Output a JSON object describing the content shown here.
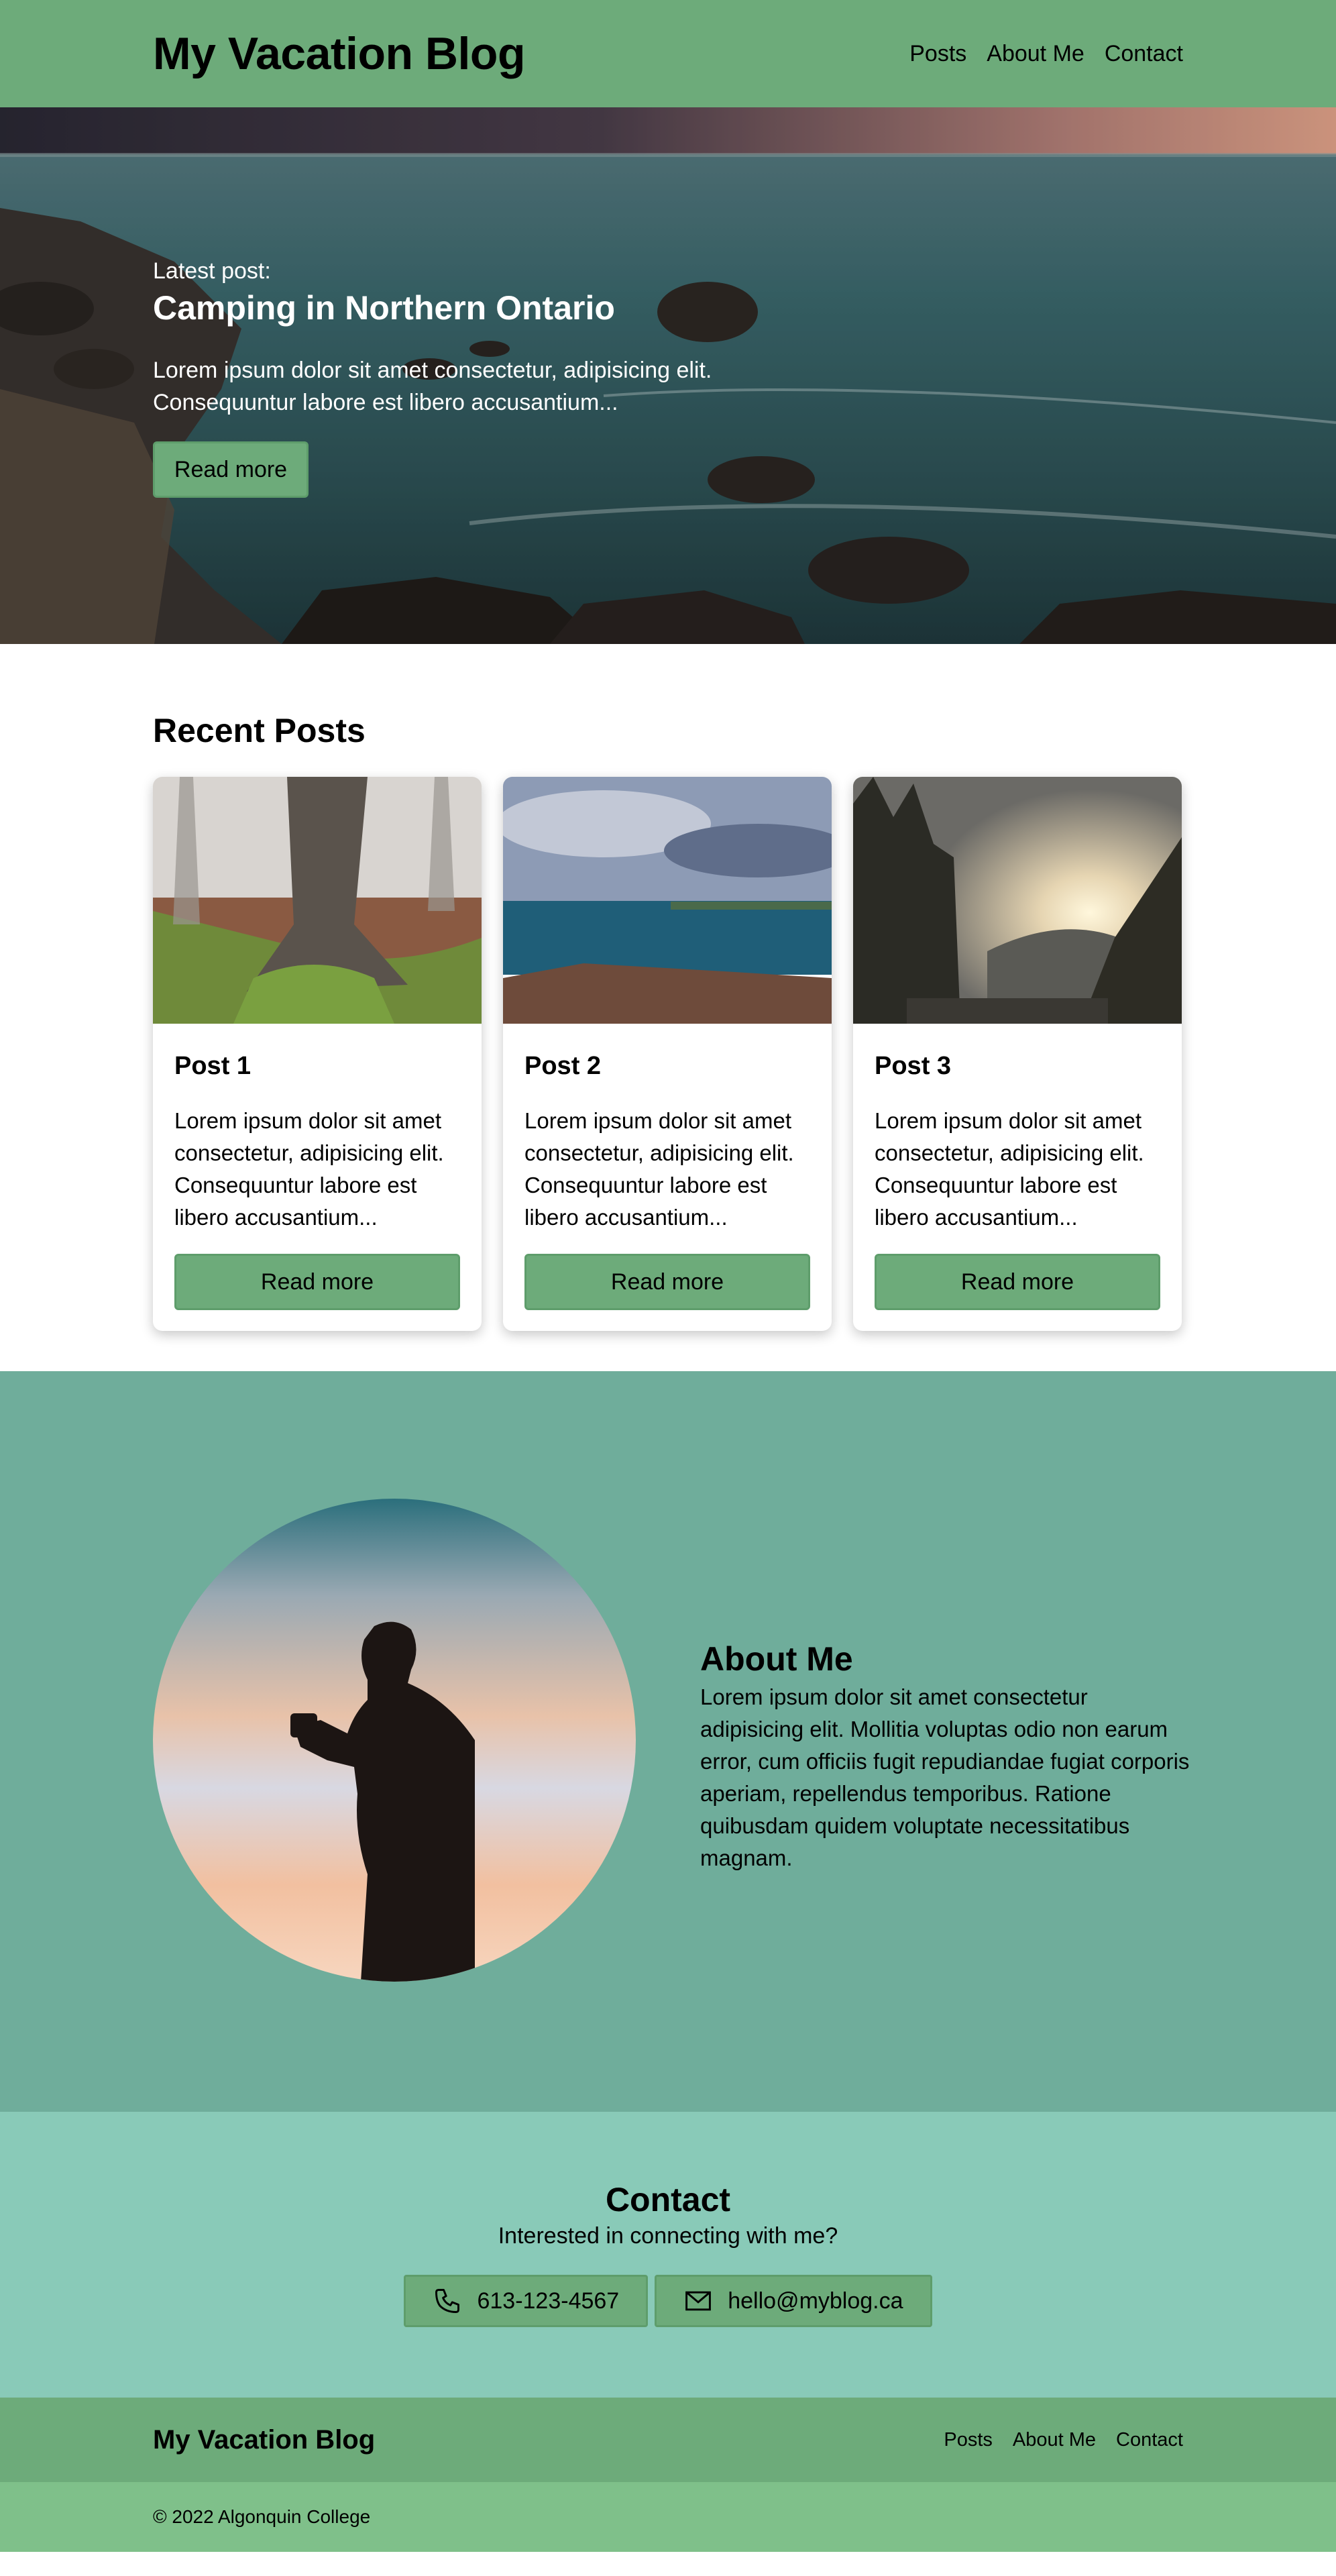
{
  "header": {
    "brand": "My Vacation Blog",
    "nav": [
      "Posts",
      "About Me",
      "Contact"
    ]
  },
  "hero": {
    "kicker": "Latest post:",
    "title": "Camping in Northern Ontario",
    "text": "Lorem ipsum dolor sit amet consectetur, adipisicing elit. Consequuntur labore est libero accusantium...",
    "button": "Read more"
  },
  "recent": {
    "title": "Recent Posts",
    "posts": [
      {
        "title": "Post 1",
        "text": "Lorem ipsum dolor sit amet consectetur, adipisicing elit. Consequuntur labore est libero accusantium...",
        "button": "Read more"
      },
      {
        "title": "Post 2",
        "text": "Lorem ipsum dolor sit amet consectetur, adipisicing elit. Consequuntur labore est libero accusantium...",
        "button": "Read more"
      },
      {
        "title": "Post 3",
        "text": "Lorem ipsum dolor sit amet consectetur, adipisicing elit. Consequuntur labore est libero accusantium...",
        "button": "Read more"
      }
    ]
  },
  "about": {
    "title": "About Me",
    "text": "Lorem ipsum dolor sit amet consectetur adipisicing elit. Mollitia voluptas odio non earum error, cum officiis fugit repudiandae fugiat corporis aperiam, repellendus temporibus. Ratione quibusdam quidem voluptate necessitatibus magnam."
  },
  "contact": {
    "title": "Contact",
    "subtitle": "Interested in connecting with me?",
    "phone": "613-123-4567",
    "email": "hello@myblog.ca",
    "phone_icon": "phone-icon",
    "email_icon": "mail-icon"
  },
  "footer": {
    "brand": "My Vacation Blog",
    "nav": [
      "Posts",
      "About Me",
      "Contact"
    ],
    "copyright": "© 2022 Algonquin College"
  },
  "colors": {
    "header_green": "#6dab7a",
    "about_teal": "#6fad9b",
    "contact_mint": "#89cab8",
    "footer_bottom": "#7fc08a"
  }
}
